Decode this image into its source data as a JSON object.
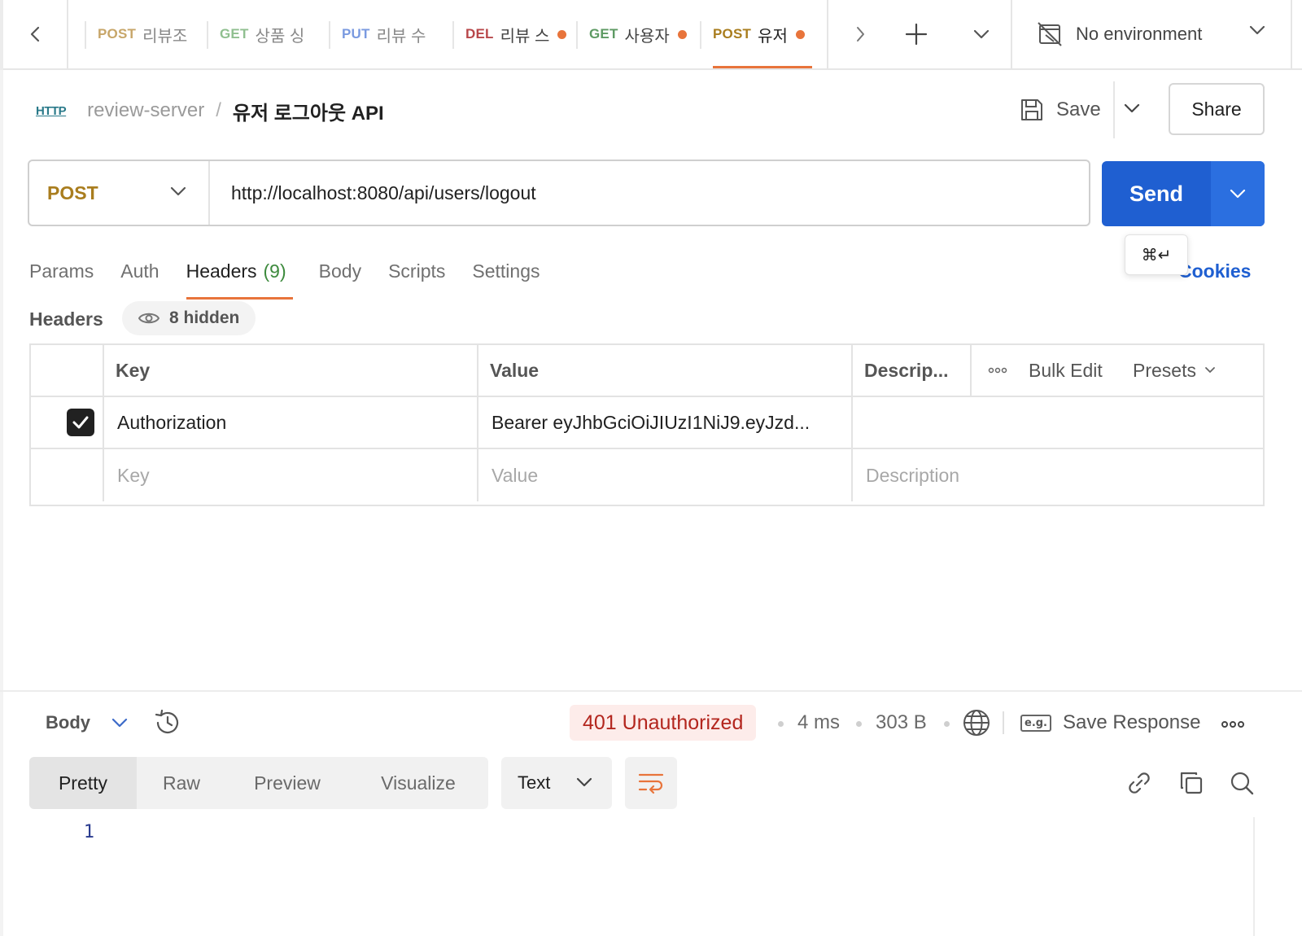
{
  "tabs": [
    {
      "method": "POST",
      "name": "리뷰조회",
      "dirty": false
    },
    {
      "method": "GET",
      "name": "상품 싱",
      "dirty": false
    },
    {
      "method": "PUT",
      "name": "리뷰 수",
      "dirty": false
    },
    {
      "method": "DEL",
      "name": "리뷰 스",
      "dirty": true
    },
    {
      "method": "GET",
      "name": "사용자",
      "dirty": true
    },
    {
      "method": "POST",
      "name": "유저",
      "dirty": true
    }
  ],
  "environment": {
    "label": "No environment"
  },
  "breadcrumb": {
    "badge": "HTTP",
    "collection": "review-server",
    "separator": "/",
    "request": "유저 로그아웃 API"
  },
  "actions": {
    "save": "Save",
    "share": "Share"
  },
  "request": {
    "method": "POST",
    "url": "http://localhost:8080/api/users/logout"
  },
  "send": {
    "label": "Send",
    "shortcut": "⌘↵"
  },
  "request_tabs": {
    "params": "Params",
    "auth": "Auth",
    "headers": "Headers",
    "headers_count": "(9)",
    "body": "Body",
    "scripts": "Scripts",
    "settings": "Settings",
    "cookies": "Cookies"
  },
  "headers_section": {
    "title": "Headers",
    "hidden": "8 hidden"
  },
  "headers_table": {
    "columns": {
      "key": "Key",
      "value": "Value",
      "description": "Descrip...",
      "bulk_edit": "Bulk Edit",
      "presets": "Presets"
    },
    "rows": [
      {
        "checked": true,
        "key": "Authorization",
        "value": "Bearer eyJhbGciOiJIUzI1NiJ9.eyJzd...",
        "description": ""
      }
    ],
    "placeholders": {
      "key": "Key",
      "value": "Value",
      "description": "Description"
    }
  },
  "response": {
    "body_label": "Body",
    "status": "401 Unauthorized",
    "time": "4 ms",
    "size": "303 B",
    "save_response": "Save Response",
    "save_badge": "e.g.",
    "views": [
      "Pretty",
      "Raw",
      "Preview",
      "Visualize"
    ],
    "active_view": "Pretty",
    "format": "Text",
    "lines": [
      "1"
    ]
  },
  "colors": {
    "accent": "#e8743b",
    "primary": "#1f5fd1",
    "post": "#a97d1e",
    "get": "#5d9a63",
    "put": "#3d6bc9",
    "delete": "#b8474a",
    "error": "#b3261e"
  }
}
